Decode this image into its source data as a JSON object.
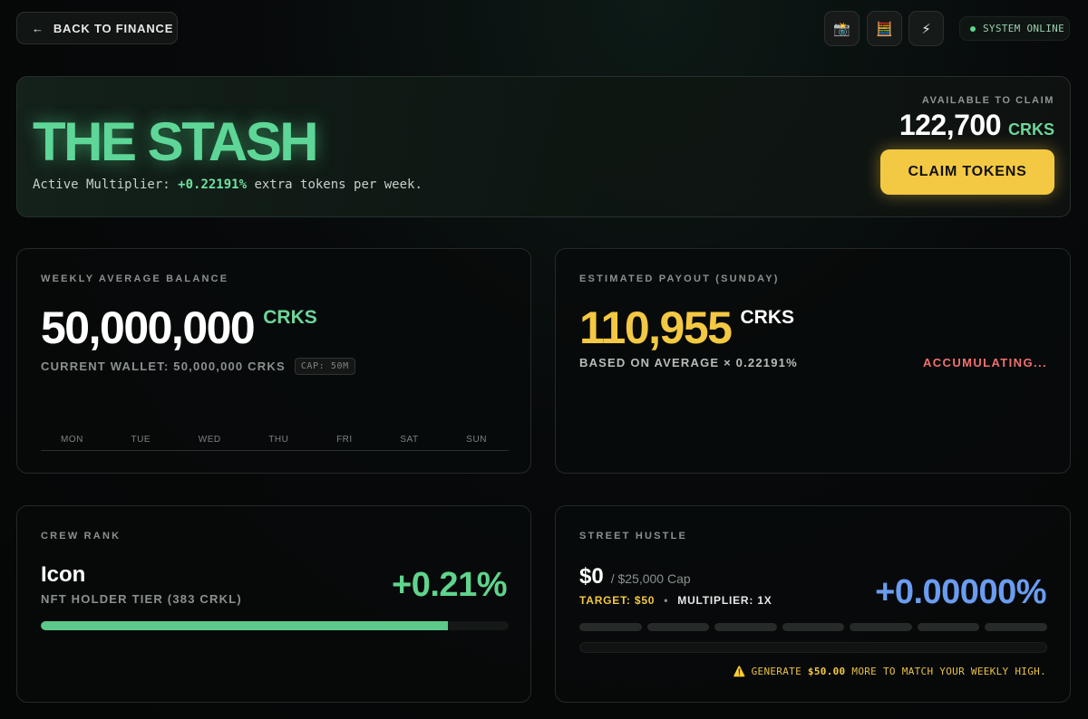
{
  "topbar": {
    "back_label": "BACK TO FINANCE",
    "icons": [
      "camera-icon",
      "abacus-icon",
      "lightning-icon"
    ],
    "status": "SYSTEM ONLINE"
  },
  "hero": {
    "title": "THE STASH",
    "sub_prefix": "Active Multiplier: ",
    "sub_value": "+0.22191%",
    "sub_suffix": " extra tokens per week.",
    "available_label": "AVAILABLE TO CLAIM",
    "available_amount": "122,700",
    "available_unit": "CRKS",
    "claim_label": "CLAIM TOKENS"
  },
  "weekly": {
    "label": "WEEKLY AVERAGE BALANCE",
    "amount": "50,000,000",
    "unit": "CRKS",
    "wallet": "CURRENT WALLET: 50,000,000 CRKS",
    "cap": "CAP: 50M",
    "days": [
      "MON",
      "TUE",
      "WED",
      "THU",
      "FRI",
      "SAT",
      "SUN"
    ]
  },
  "payout": {
    "label": "ESTIMATED PAYOUT (SUNDAY)",
    "amount": "110,955",
    "unit": "CRKS",
    "basis": "BASED ON AVERAGE × 0.22191%",
    "status": "ACCUMULATING..."
  },
  "rank": {
    "label": "CREW RANK",
    "name": "Icon",
    "tier": "NFT HOLDER TIER (383 CRKL)",
    "percent": "+0.21%",
    "progress": 0.87
  },
  "hustle": {
    "label": "STREET HUSTLE",
    "amount": "$0",
    "cap": "/ $25,000 Cap",
    "target": "TARGET: $50",
    "dot": "•",
    "multiplier": "MULTIPLIER: 1X",
    "percent": "+0.00000%",
    "segments": 7,
    "warn_prefix": "GENERATE ",
    "warn_amount": "$50.00",
    "warn_suffix": " MORE TO MATCH YOUR WEEKLY HIGH."
  },
  "colors": {
    "accent_green": "#5ed697",
    "accent_yellow": "#f3c843",
    "accent_blue": "#6a9cf0",
    "accent_red": "#f07070"
  }
}
